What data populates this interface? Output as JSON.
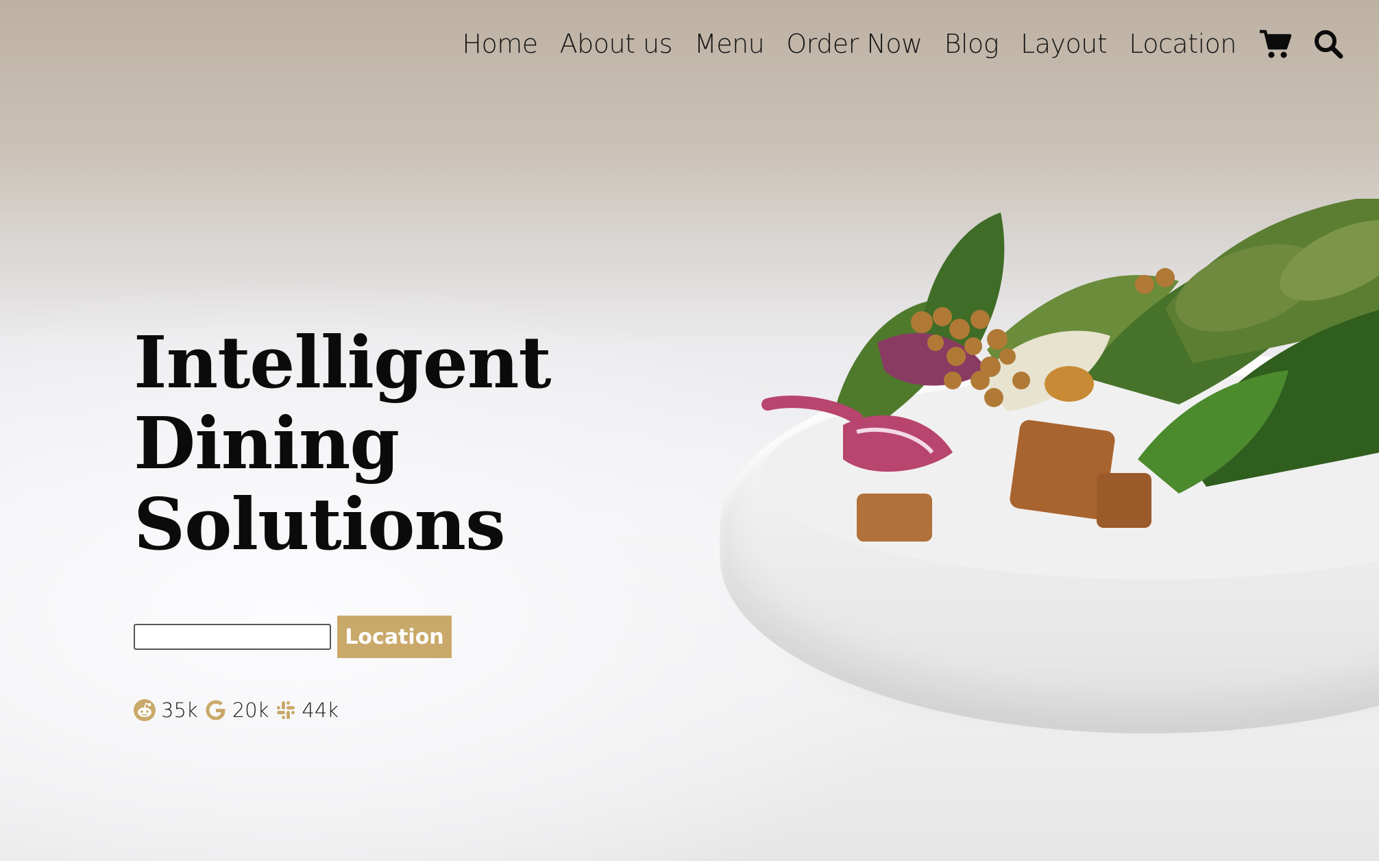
{
  "nav": {
    "links": [
      "Home",
      "About us",
      "Menu",
      "Order Now",
      "Blog",
      "Layout",
      "Location"
    ],
    "cart_icon": "shopping-cart-icon",
    "search_icon": "search-icon"
  },
  "hero": {
    "headline": [
      "Intelligent",
      "Dining",
      "Solutions"
    ],
    "location_input": {
      "value": "",
      "placeholder": ""
    },
    "location_button": "Location"
  },
  "social": [
    {
      "icon": "reddit-icon",
      "count": "35k"
    },
    {
      "icon": "google-icon",
      "count": "20k"
    },
    {
      "icon": "slack-icon",
      "count": "44k"
    }
  ],
  "colors": {
    "accent": "#c9a96a",
    "text": "#0b0b0b"
  }
}
